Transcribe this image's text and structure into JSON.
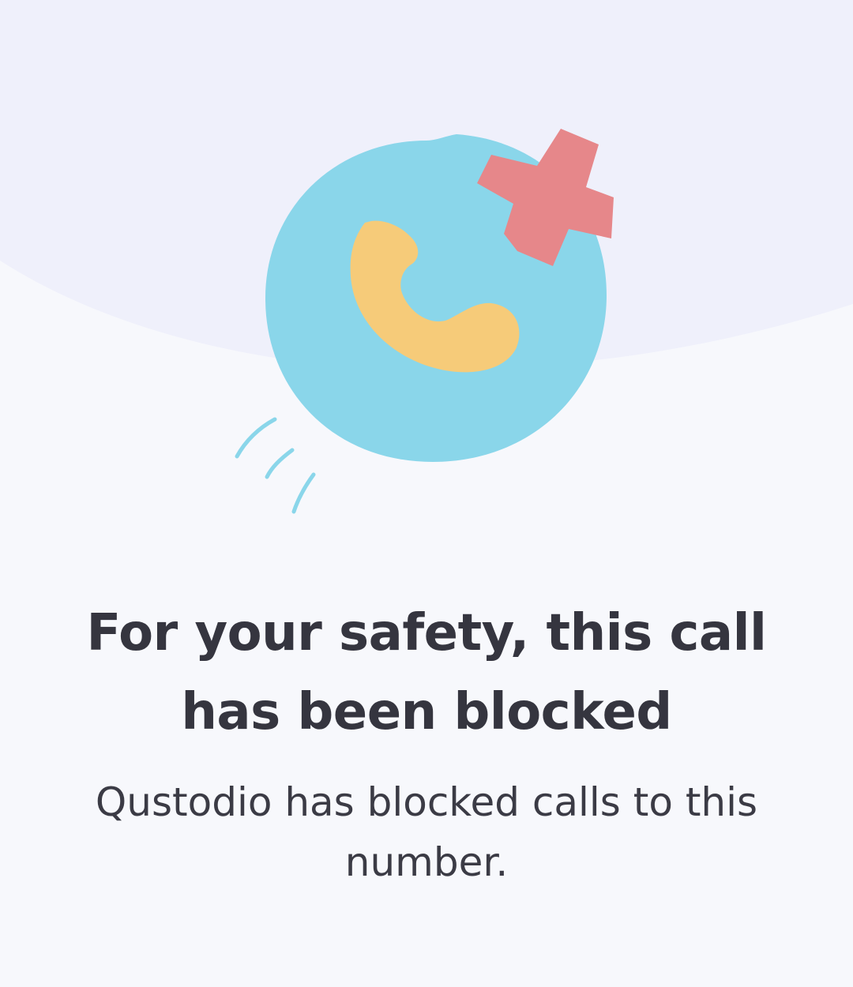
{
  "blocked_screen": {
    "title": "For your safety, this call has been blocked",
    "message": "Qustodio has blocked calls to this number.",
    "illustration": {
      "icons": [
        "phone-icon",
        "blocked-cross-icon",
        "motion-lines-icon"
      ],
      "colors": {
        "background": "#f7f8fc",
        "header_blob": "#eff0fb",
        "circle": "#8ad6ea",
        "phone": "#f6cb79",
        "cross": "#e6878a",
        "motion_lines": "#8ad6ea"
      }
    },
    "text_colors": {
      "title": "#35353f",
      "message": "#3b3b45"
    }
  }
}
